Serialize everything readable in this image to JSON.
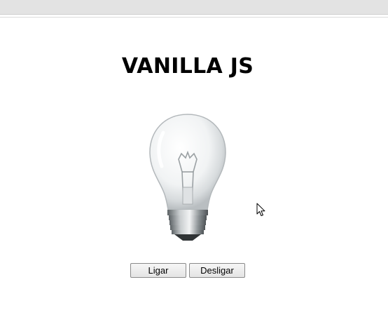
{
  "page": {
    "title": "VANILLA JS"
  },
  "bulb": {
    "state": "off",
    "icon": "lightbulb-icon"
  },
  "controls": {
    "on_label": "Ligar",
    "off_label": "Desligar"
  },
  "cursor": {
    "icon": "mouse-pointer-icon"
  }
}
